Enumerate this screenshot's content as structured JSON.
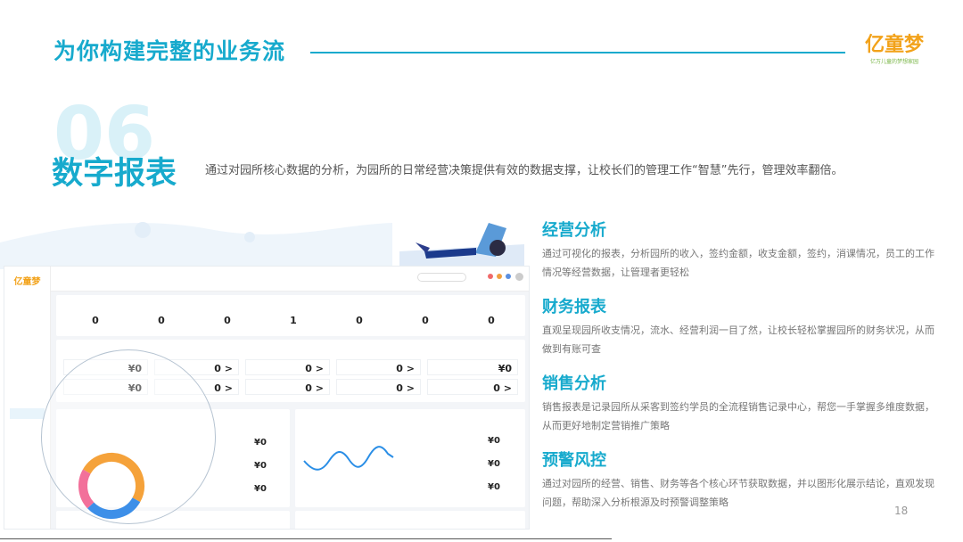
{
  "header": {
    "title": "为你构建完整的业务流",
    "logo_text": "亿童梦",
    "logo_sub": "亿万儿童的梦想家园"
  },
  "section": {
    "number": "06",
    "title": "数字报表",
    "description": "通过对园所核心数据的分析，为园所的日常经营决策提供有效的数据支撑，让校长们的管理工作“智慧”先行，管理效率翻倍。"
  },
  "features": [
    {
      "title": "经营分析",
      "desc": "通过可视化的报表，分析园所的收入，签约金额，收支金额，签约，消课情况，员工的工作情况等经营数据，让管理者更轻松"
    },
    {
      "title": "财务报表",
      "desc": "直观呈现园所收支情况，流水、经营利润一目了然，让校长轻松掌握园所的财务状况，从而做到有账可查"
    },
    {
      "title": "销售分析",
      "desc": "销售报表是记录园所从采客到签约学员的全流程销售记录中心，帮您一手掌握多维度数据，从而更好地制定营销推广策略"
    },
    {
      "title": "预警风控",
      "desc": "通过对园所的经营、销售、财务等各个核心环节获取数据，并以图形化展示结论，直观发现问题，帮助深入分析根源及时预警调整策略"
    }
  ],
  "page_number": "18",
  "dashboard": {
    "kpis": [
      "0",
      "0",
      "0",
      "1",
      "0",
      "0",
      "0"
    ],
    "summary": [
      {
        "value": "¥0"
      },
      {
        "value": "0 >"
      },
      {
        "value": "0 >"
      },
      {
        "value": "0 >"
      },
      {
        "value": "¥0"
      },
      {
        "value": "¥0"
      },
      {
        "value": "0 >"
      },
      {
        "value": "0 >"
      },
      {
        "value": "0 >"
      },
      {
        "value": "0 >"
      }
    ],
    "amounts": [
      "¥0",
      "¥0",
      "¥0",
      "¥0",
      "¥0",
      "¥0"
    ]
  }
}
